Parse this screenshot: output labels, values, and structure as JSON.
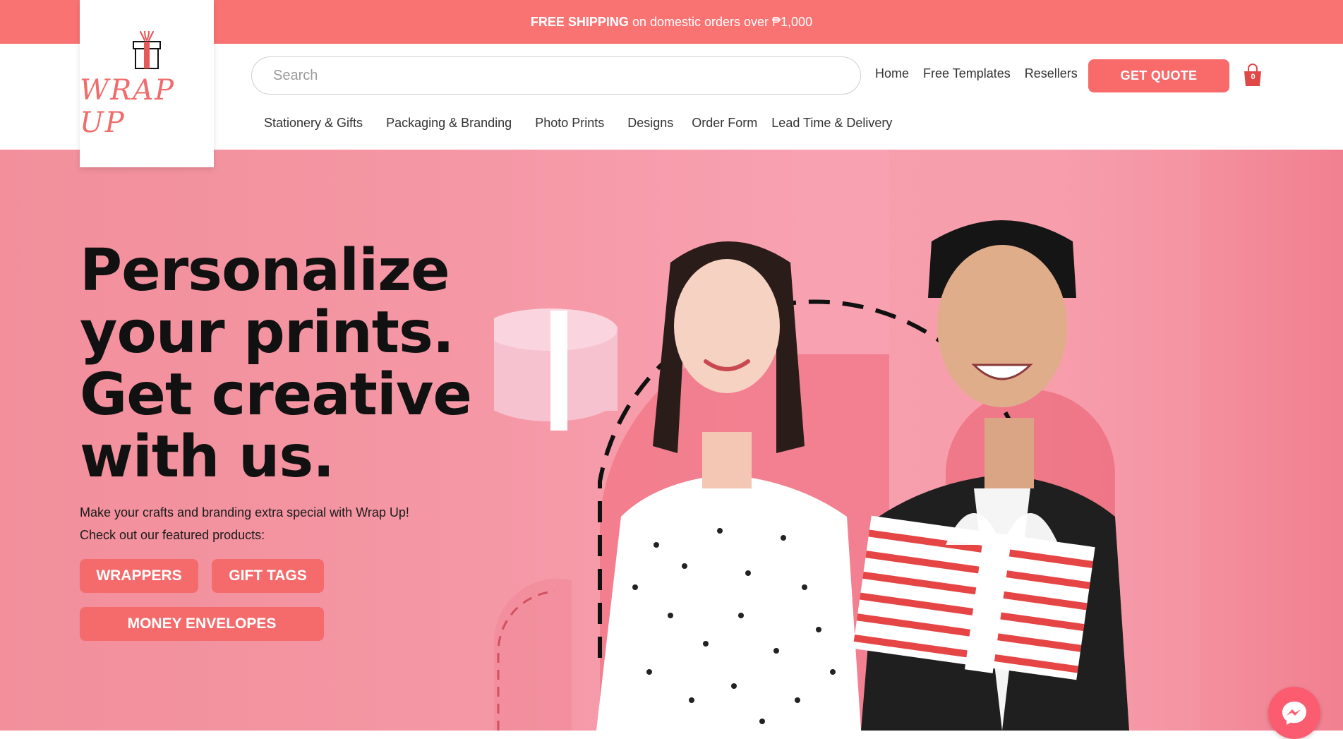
{
  "promo": {
    "bold": "FREE SHIPPING",
    "rest": "on domestic orders over ₱1,000"
  },
  "brand": {
    "name": "WRAP UP",
    "accent": "#f96b6b"
  },
  "search": {
    "placeholder": "Search",
    "value": ""
  },
  "top_nav": [
    "Home",
    "Free Templates",
    "Resellers"
  ],
  "quote_button": "GET QUOTE",
  "cart": {
    "count": "0",
    "icon": "shopping-bag-icon"
  },
  "main_nav": [
    "Stationery & Gifts",
    "Packaging & Branding",
    "Photo Prints",
    "Designs",
    "Order Form",
    "Lead Time & Delivery"
  ],
  "hero": {
    "headline_lines": [
      "Personalize",
      "your prints.",
      "Get creative",
      "with us."
    ],
    "sub_lines": [
      "Make your crafts and branding extra special with Wrap Up!",
      "Check out our featured products:"
    ],
    "buttons": [
      "WRAPPERS",
      "GIFT TAGS",
      "MONEY ENVELOPES"
    ]
  },
  "chat": {
    "icon": "messenger-icon"
  }
}
